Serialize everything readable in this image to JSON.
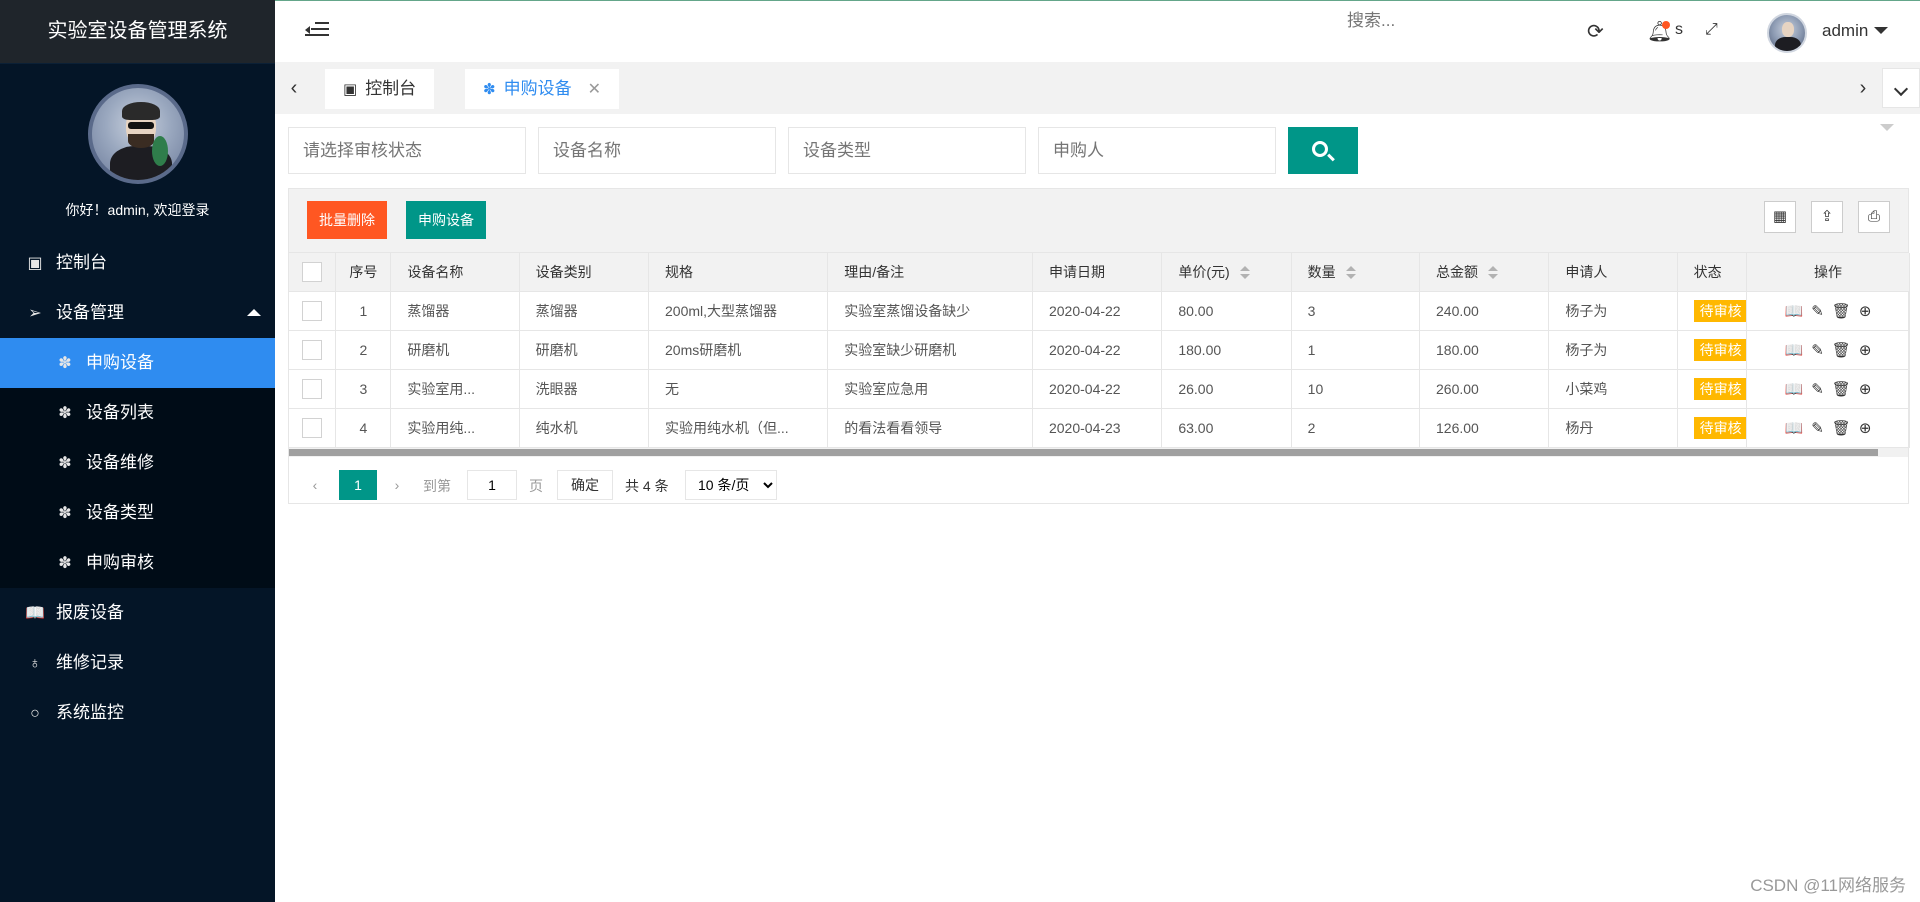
{
  "app": {
    "title": "实验室设备管理系统"
  },
  "sidebar": {
    "welcome": "你好！admin, 欢迎登录",
    "items": [
      {
        "icon": "dashboard-icon",
        "label": "控制台"
      },
      {
        "icon": "paper-plane-icon",
        "label": "设备管理",
        "expanded": true,
        "children": [
          {
            "icon": "palm-icon",
            "label": "申购设备",
            "active": true
          },
          {
            "icon": "palm-icon",
            "label": "设备列表"
          },
          {
            "icon": "palm-icon",
            "label": "设备维修"
          },
          {
            "icon": "palm-icon",
            "label": "设备类型"
          },
          {
            "icon": "palm-icon",
            "label": "申购审核"
          }
        ]
      },
      {
        "icon": "book-icon",
        "label": "报废设备"
      },
      {
        "icon": "drops-icon",
        "label": "维修记录"
      },
      {
        "icon": "circle-icon",
        "label": "系统监控"
      }
    ]
  },
  "header": {
    "search_placeholder": "搜索...",
    "notice_label": "s",
    "username": "admin"
  },
  "tabs": [
    {
      "label": "控制台"
    },
    {
      "label": "申购设备",
      "active": true,
      "close": "✕"
    }
  ],
  "filters": {
    "status_placeholder": "请选择审核状态",
    "name_placeholder": "设备名称",
    "type_placeholder": "设备类型",
    "applicant_placeholder": "申购人"
  },
  "toolbar": {
    "batch_delete": "批量删除",
    "purchase": "申购设备"
  },
  "table": {
    "columns": [
      "序号",
      "设备名称",
      "设备类别",
      "规格",
      "理由/备注",
      "申请日期",
      "单价(元)",
      "数量",
      "总金额",
      "申请人",
      "状态",
      "操作"
    ],
    "rows": [
      {
        "no": "1",
        "name": "蒸馏器",
        "category": "蒸馏器",
        "spec": "200ml,大型蒸馏器",
        "reason": "实验室蒸馏设备缺少",
        "date": "2020-04-22",
        "price": "80.00",
        "qty": "3",
        "total": "240.00",
        "applicant": "杨子为",
        "status": "待审核"
      },
      {
        "no": "2",
        "name": "研磨机",
        "category": "研磨机",
        "spec": "20ms研磨机",
        "reason": "实验室缺少研磨机",
        "date": "2020-04-22",
        "price": "180.00",
        "qty": "1",
        "total": "180.00",
        "applicant": "杨子为",
        "status": "待审核"
      },
      {
        "no": "3",
        "name": "实验室用...",
        "category": "洗眼器",
        "spec": "无",
        "reason": "实验室应急用",
        "date": "2020-04-22",
        "price": "26.00",
        "qty": "10",
        "total": "260.00",
        "applicant": "小菜鸡",
        "status": "待审核"
      },
      {
        "no": "4",
        "name": "实验用纯...",
        "category": "纯水机",
        "spec": "实验用纯水机（但...",
        "reason": "的看法看看领导",
        "date": "2020-04-23",
        "price": "63.00",
        "qty": "2",
        "total": "126.00",
        "applicant": "杨丹",
        "status": "待审核"
      }
    ]
  },
  "pager": {
    "current": "1",
    "goto_label": "到第",
    "goto_value": "1",
    "page_label": "页",
    "confirm": "确定",
    "total": "共 4 条",
    "per_page": "10 条/页"
  },
  "watermark": "CSDN @11网络服务"
}
